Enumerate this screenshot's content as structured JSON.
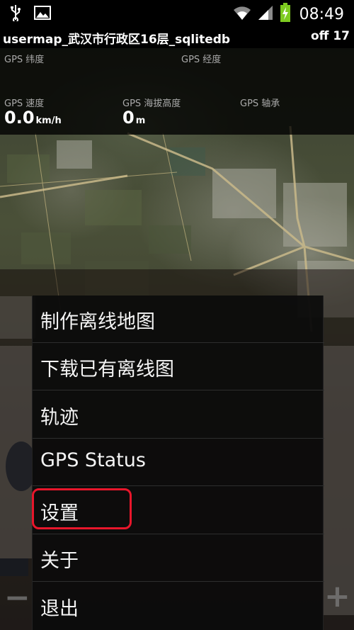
{
  "status_bar": {
    "time": "08:49",
    "icons": [
      "usb-icon",
      "image-icon",
      "wifi-icon",
      "signal-icon",
      "battery-charging-icon"
    ]
  },
  "title_bar": {
    "title": "usermap_武汉市行政区16层_sqlitedb",
    "right_text": "off 17"
  },
  "gps": {
    "latitude_label": "GPS 纬度",
    "longitude_label": "GPS 经度",
    "speed_label": "GPS 速度",
    "speed_value": "0.0",
    "speed_unit": "km/h",
    "altitude_label": "GPS 海拔高度",
    "altitude_value": "0",
    "altitude_unit": "m",
    "bearing_label": "GPS 轴承"
  },
  "menu": {
    "items": [
      {
        "label": "制作离线地图"
      },
      {
        "label": "下载已有离线图"
      },
      {
        "label": "轨迹"
      },
      {
        "label": "GPS Status"
      },
      {
        "label": "设置"
      },
      {
        "label": "关于"
      },
      {
        "label": "退出"
      }
    ],
    "highlighted_index": 4,
    "highlight_color": "#e8162b"
  },
  "zoom": {
    "minus": "−",
    "plus": "+"
  }
}
